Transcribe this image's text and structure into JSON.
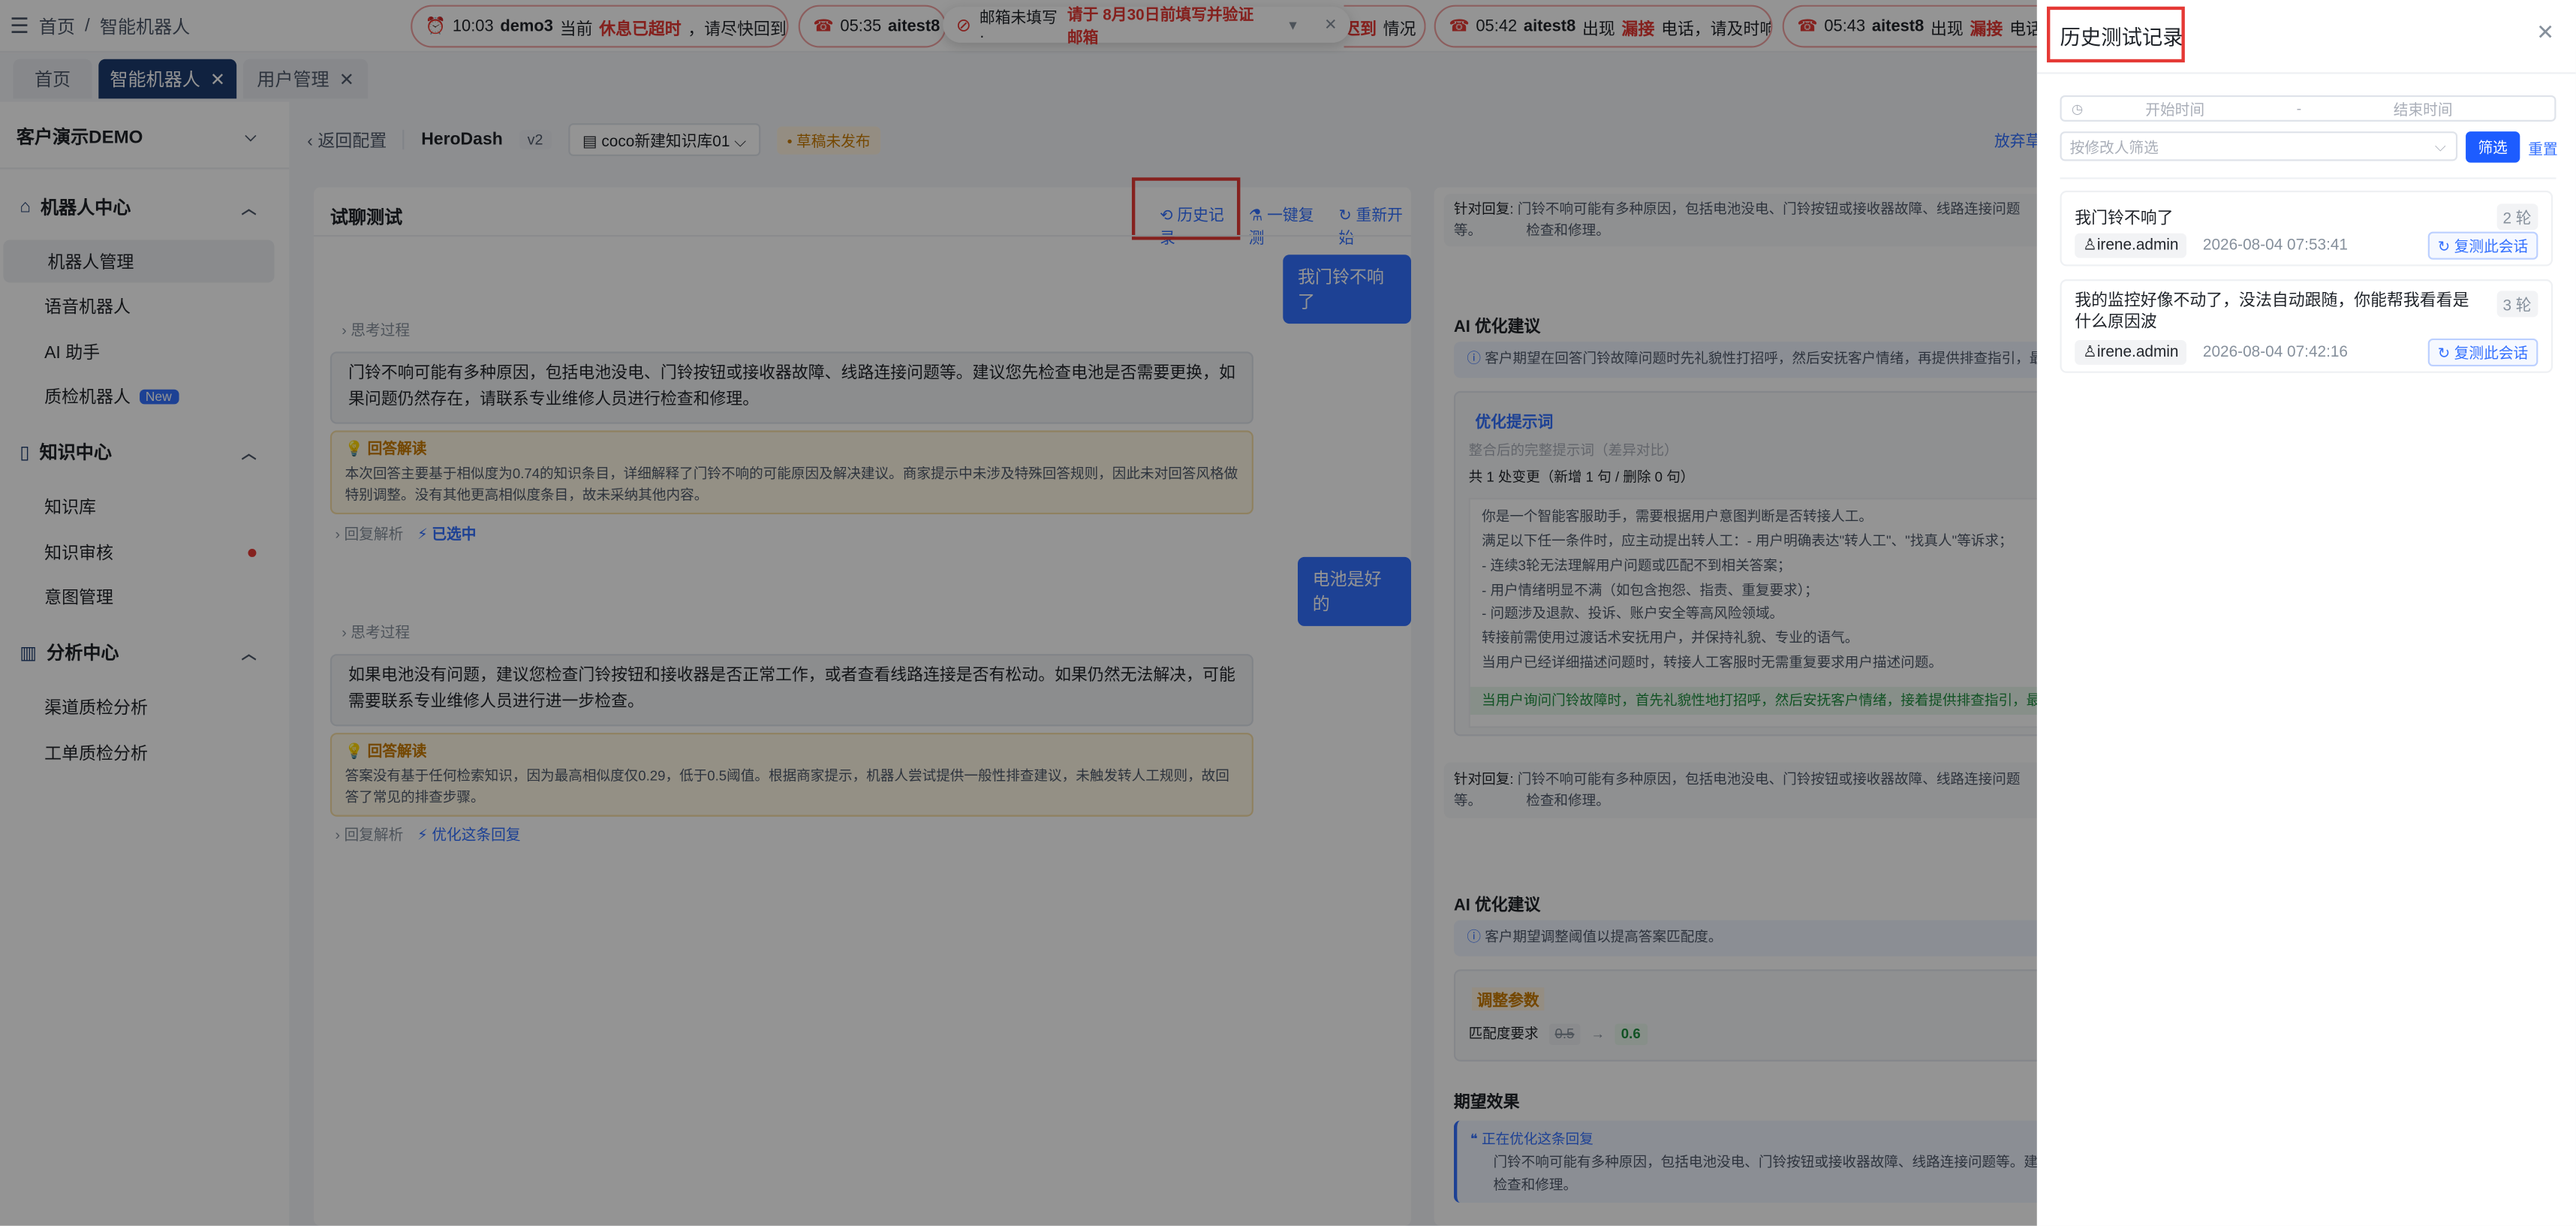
{
  "breadcrumb": {
    "home": "首页",
    "separator": "/",
    "current": "智能机器人"
  },
  "tickers": [
    {
      "time": "10:03",
      "user": "demo3",
      "pre": " 当前",
      "alert": "休息已超时",
      "post": "，请尽快回到岗位"
    },
    {
      "time": "05:35",
      "user": "aitest8",
      "pre": "",
      "alert": "",
      "post": ""
    },
    {
      "time": "",
      "user": "",
      "pre": "",
      "alert": "迟到",
      "post": "情况"
    },
    {
      "time": "05:42",
      "user": "aitest8",
      "pre": " 出现",
      "alert": "漏接",
      "post": "电话，请及时响应"
    },
    {
      "time": "05:43",
      "user": "aitest8",
      "pre": " 出现",
      "alert": "漏接",
      "post": "电话，"
    }
  ],
  "mail_tip": {
    "pre": "邮箱未填写 · ",
    "alert": "请于 8月30日前填写并验证邮箱"
  },
  "tabs": [
    {
      "label": "首页"
    },
    {
      "label": "智能机器人"
    },
    {
      "label": "用户管理"
    }
  ],
  "sidebar": {
    "tenant": "客户演示DEMO",
    "groups": [
      {
        "label": "机器人中心",
        "items": [
          "机器人管理",
          "语音机器人",
          "AI 助手",
          "质检机器人"
        ]
      },
      {
        "label": "知识中心",
        "items": [
          "知识库",
          "知识审核",
          "意图管理"
        ]
      },
      {
        "label": "分析中心",
        "items": [
          "渠道质检分析",
          "工单质检分析"
        ]
      }
    ],
    "new_badge": "New"
  },
  "subheader": {
    "back": "返回配置",
    "bot_name": "HeroDash",
    "version": "v2",
    "kb": "coco新建知识库01",
    "draft": "草稿未发布",
    "abandon": "放弃草"
  },
  "chat": {
    "title": "试聊测试",
    "history_btn": "历史记录",
    "copy_btn": "一键复测",
    "restart_btn": "重新开始",
    "user_msg_1": "我门铃不响了",
    "think_label": "思考过程",
    "answer_1": "门铃不响可能有多种原因，包括电池没电、门铃按钮或接收器故障、线路连接问题等。建议您先检查电池是否需要更换，如果问题仍然存在，请联系专业维修人员进行检查和修理。",
    "interp_title": "回答解读",
    "interp_1": "本次回答主要基于相似度为0.74的知识条目，详细解释了门铃不响的可能原因及解决建议。商家提示中未涉及特殊回答规则，因此未对回答风格做特别调整。没有其他更高相似度条目，故未采纳其他内容。",
    "analysis_label": "回复解析",
    "selected_label": "已选中",
    "user_msg_2": "电池是好的",
    "answer_2": "如果电池没有问题，建议您检查门铃按钮和接收器是否正常工作，或者查看线路连接是否有松动。如果仍然无法解决，可能需要联系专业维修人员进行进一步检查。",
    "interp_2": "答案没有基于任何检索知识，因为最高相似度仅0.29，低于0.5阈值。根据商家提示，机器人尝试提供一般性排查建议，未触发转人工规则，故回答了常见的排查步骤。",
    "optimize_label": "优化这条回复"
  },
  "right": {
    "target_label": "针对回复:",
    "target_text": "门铃不响可能有多种原因，包括电池没电、门铃按钮或接收器故障、线路连接问题等。",
    "target_text2": "检查和修理。",
    "ai_title": "AI 优化建议",
    "ai_hint": "客户期望在回答门铃故障问题时先礼貌性打招呼，然后安抚客户情绪，再提供排查指引，最后",
    "prompt_title": "优化提示词",
    "prompt_sub": "整合后的完整提示词（差异对比）",
    "prompt_change": "共 1 处变更（新增 1 句 / 删除 0 句）",
    "prompt_lines": [
      "你是一个智能客服助手，需要根据用户意图判断是否转接人工。",
      "满足以下任一条件时，应主动提出转人工：- 用户明确表达\"转人工\"、\"找真人\"等诉求；",
      "- 连续3轮无法理解用户问题或匹配不到相关答案；",
      "- 用户情绪明显不满（如包含抱怨、指责、重复要求）；",
      "- 问题涉及退款、投诉、账户安全等高风险领域。",
      "转接前需使用过渡话术安抚用户，并保持礼貌、专业的语气。",
      "当用户已经详细描述问题时，转接人工客服时无需重复要求用户描述问题。"
    ],
    "prompt_added": "当用户询问门铃故障时，首先礼貌性地打招呼，然后安抚客户情绪，接着提供排查指引，最后",
    "ai_hint2": "客户期望调整阈值以提高答案匹配度。",
    "param_title": "调整参数",
    "param_label": "匹配度要求",
    "param_old": "0.5",
    "param_arrow": "→",
    "param_new": "0.6",
    "expect_title": "期望效果",
    "expect_sub": "正在优化这条回复",
    "expect_text": "门铃不响可能有多种原因，包括电池没电、门铃按钮或接收器故障、线路连接问题等。建议",
    "expect_text2": "检查和修理。"
  },
  "drawer": {
    "title": "历史测试记录",
    "start_ph": "开始时间",
    "range_sep": "-",
    "end_ph": "结束时间",
    "editor_ph": "按修改人筛选",
    "filter_btn": "筛选",
    "reset_btn": "重置",
    "records": [
      {
        "title": "我门铃不响了",
        "rounds": "2 轮",
        "user": "irene.admin",
        "time": "2026-08-04 07:53:41",
        "replay": "复测此会话"
      },
      {
        "title": "我的监控好像不动了，没法自动跟随，你能帮我看看是什么原因波",
        "rounds": "3 轮",
        "user": "irene.admin",
        "time": "2026-08-04 07:42:16",
        "replay": "复测此会话"
      }
    ]
  },
  "colors": {
    "accent": "#3370ff",
    "alert": "#e53935",
    "nav_active": "#1d3b6e"
  }
}
